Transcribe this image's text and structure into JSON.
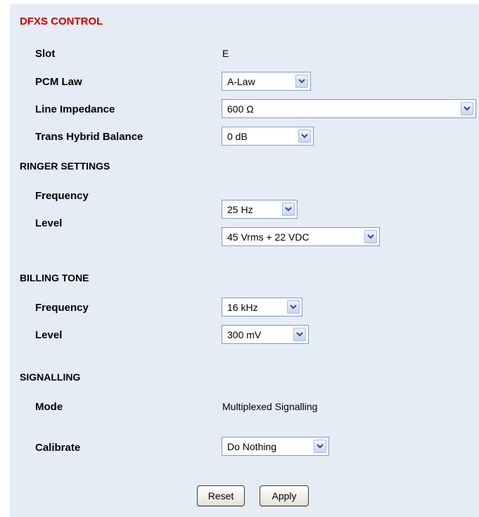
{
  "title": "DFXS CONTROL",
  "control": {
    "slot_label": "Slot",
    "slot_value": "E",
    "pcm_law_label": "PCM Law",
    "pcm_law_value": "A-Law",
    "line_impedance_label": "Line Impedance",
    "line_impedance_value": "600 Ω",
    "trans_hybrid_label": "Trans Hybrid Balance",
    "trans_hybrid_value": "0 dB"
  },
  "ringer": {
    "heading": "RINGER SETTINGS",
    "frequency_label": "Frequency",
    "frequency_value": "25 Hz",
    "level_label": "Level",
    "level_value": "45 Vrms + 22 VDC"
  },
  "billing": {
    "heading": "BILLING TONE",
    "frequency_label": "Frequency",
    "frequency_value": "16 kHz",
    "level_label": "Level",
    "level_value": "300 mV"
  },
  "signalling": {
    "heading": "SIGNALLING",
    "mode_label": "Mode",
    "mode_value": "Multiplexed Signalling",
    "calibrate_label": "Calibrate",
    "calibrate_value": "Do Nothing"
  },
  "buttons": {
    "reset": "Reset",
    "apply": "Apply"
  },
  "colors": {
    "panel_bg": "#e6ecf5",
    "title": "#cc0000"
  }
}
